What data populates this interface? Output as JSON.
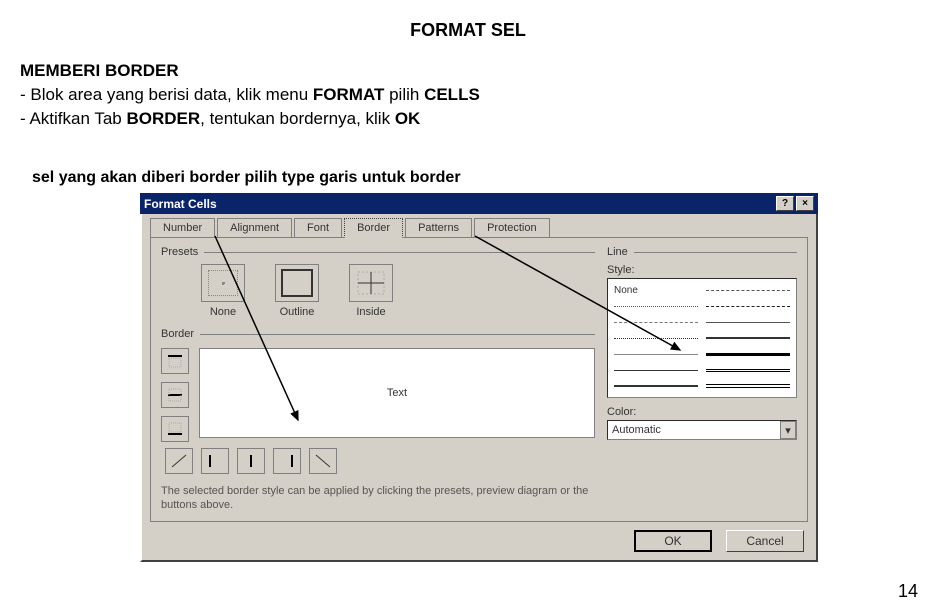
{
  "title": "FORMAT SEL",
  "subtitle": "MEMBERI BORDER",
  "instructions": [
    {
      "prefix": "- Blok area yang berisi data, klik menu ",
      "b1": "FORMAT",
      "mid": " pilih ",
      "b2": "CELLS"
    },
    {
      "prefix": "- Aktifkan Tab ",
      "b1": "BORDER",
      "mid": ", tentukan bordernya, klik ",
      "b2": "OK"
    }
  ],
  "annotation": "sel yang akan diberi border pilih type garis untuk border",
  "page_number": "14",
  "dialog": {
    "title": "Format Cells",
    "help": "?",
    "close": "×",
    "tabs": [
      "Number",
      "Alignment",
      "Font",
      "Border",
      "Patterns",
      "Protection"
    ],
    "active_tab": 3,
    "presets_label": "Presets",
    "presets": {
      "none": "None",
      "outline": "Outline",
      "inside": "Inside"
    },
    "border_label": "Border",
    "preview_text": "Text",
    "note": "The selected border style can be applied by clicking the presets, preview diagram or the buttons above.",
    "line_label": "Line",
    "style_label": "Style:",
    "style_none": "None",
    "color_label": "Color:",
    "color_value": "Automatic",
    "ok": "OK",
    "cancel": "Cancel"
  }
}
